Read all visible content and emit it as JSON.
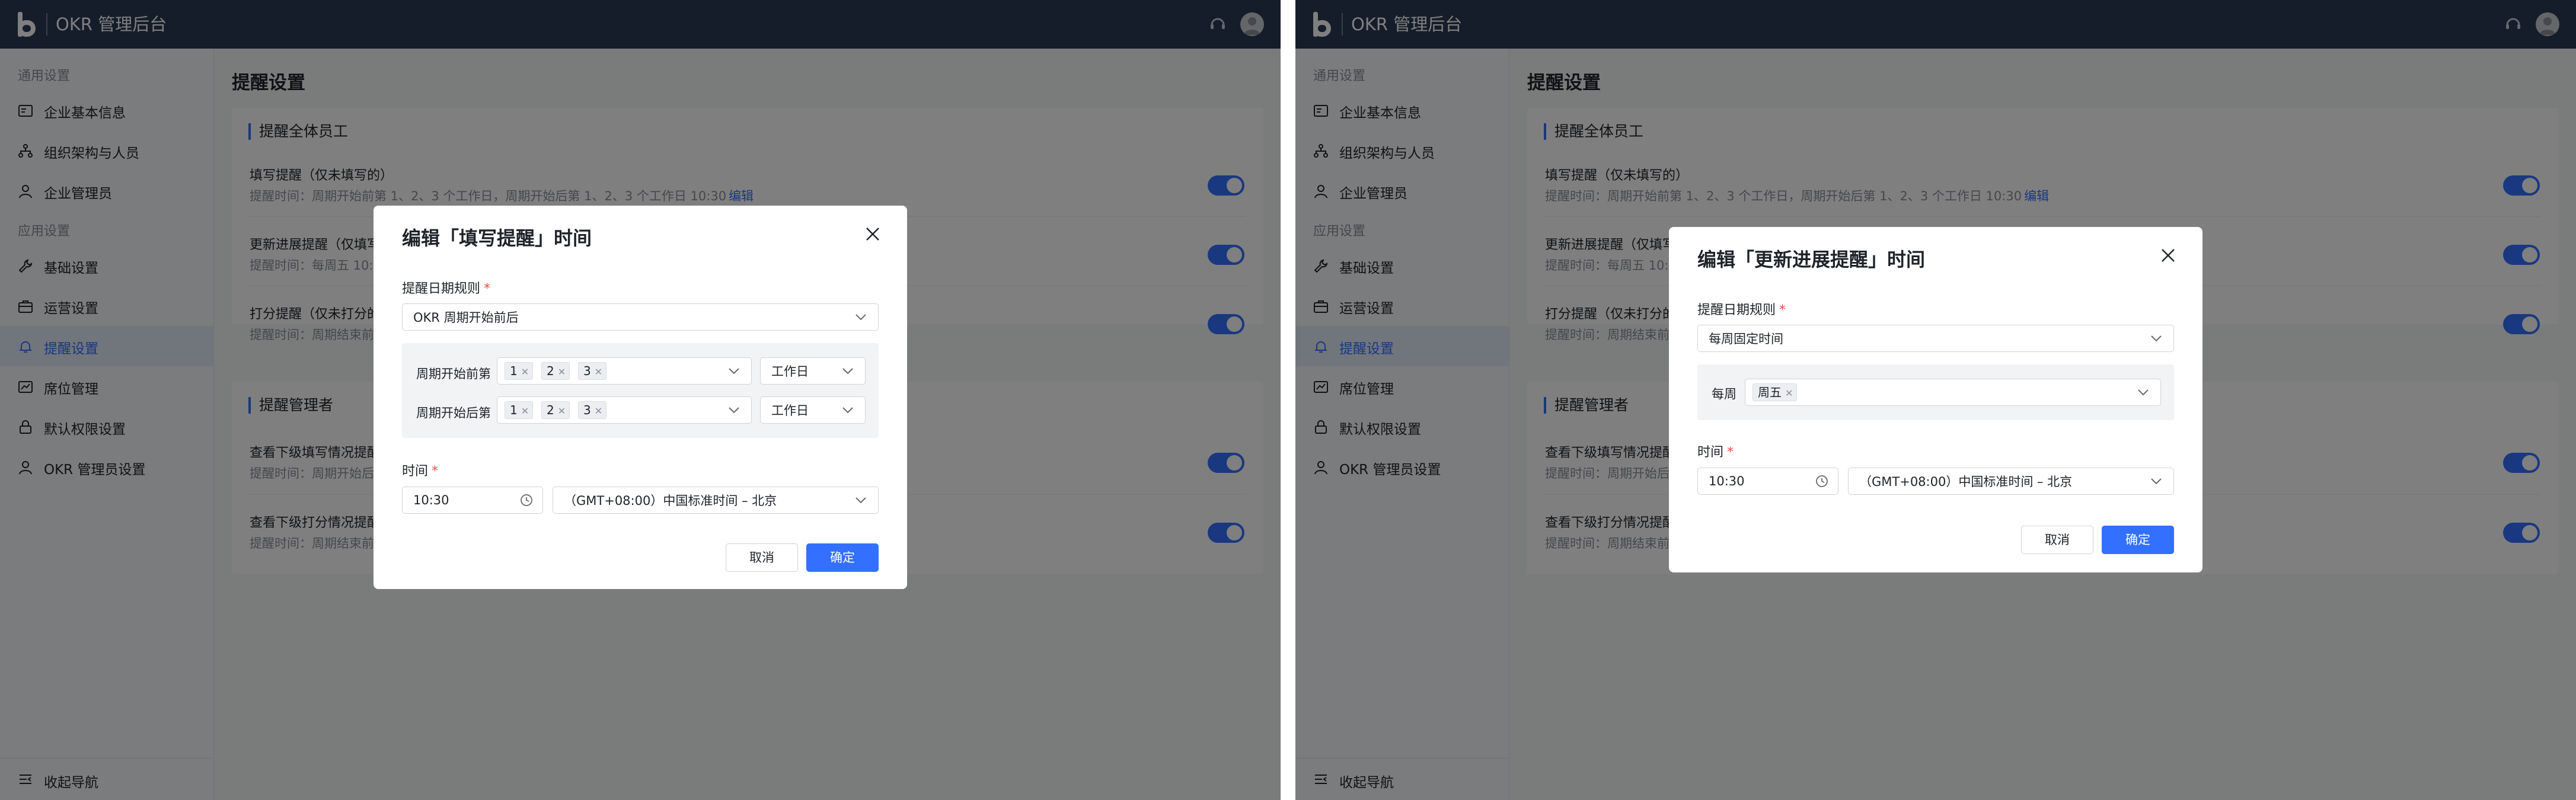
{
  "app": {
    "title": "OKR 管理后台"
  },
  "sidebar": {
    "group_general": "通用设置",
    "group_app": "应用设置",
    "items": [
      {
        "label": "企业基本信息",
        "icon": "company-info-icon"
      },
      {
        "label": "组织架构与人员",
        "icon": "org-structure-icon"
      },
      {
        "label": "企业管理员",
        "icon": "admin-user-icon"
      },
      {
        "label": "基础设置",
        "icon": "wrench-icon"
      },
      {
        "label": "运营设置",
        "icon": "briefcase-icon"
      },
      {
        "label": "提醒设置",
        "icon": "bell-icon",
        "active": true
      },
      {
        "label": "席位管理",
        "icon": "seat-card-icon"
      },
      {
        "label": "默认权限设置",
        "icon": "lock-icon"
      },
      {
        "label": "OKR 管理员设置",
        "icon": "user-icon"
      }
    ],
    "collapse_label": "收起导航"
  },
  "main": {
    "page_title": "提醒设置",
    "section_all": {
      "title": "提醒全体员工",
      "rows": [
        {
          "title": "填写提醒（仅未填写的）",
          "desc": "提醒时间：周期开始前第 1、2、3 个工作日，周期开始后第 1、2、3 个工作日 10:30",
          "edit": "编辑",
          "enabled": true
        },
        {
          "title": "更新进展提醒（仅填写",
          "desc": "提醒时间：每周五 10:3",
          "enabled": true
        },
        {
          "title": "打分提醒（仅未打分的",
          "desc": "提醒时间：周期结束前",
          "enabled": true
        }
      ]
    },
    "section_managers": {
      "title": "提醒管理者",
      "rows": [
        {
          "title": "查看下级填写情况提醒",
          "desc": "提醒时间：周期开始后",
          "enabled": true
        },
        {
          "title": "查看下级打分情况提醒",
          "desc": "提醒时间：周期结束前",
          "enabled": true
        }
      ]
    }
  },
  "main_right": {
    "row1_title": "填写提醒（仅未填写的）",
    "row1_desc": "提醒时间：周期开始前第 1、2、3 个工作日，周期开始后第 1、2、3 个工作日 10:30",
    "row1_edit": "编辑",
    "row2_title": "更新进展提醒（仅填写",
    "row2_desc": "提醒时间：每周五 10:3",
    "row3_title": "打分提醒（仅未打分的",
    "row3_desc": "提醒时间：周期结束前",
    "row4_title": "查看下级填写情况提醒",
    "row4_desc": "提醒时间：周期开始后",
    "row5_title": "查看下级打分情况提醒",
    "row5_desc": "提醒时间：周期结束前"
  },
  "modal_fill": {
    "title": "编辑「填写提醒」时间",
    "date_rule_label": "提醒日期规则",
    "date_rule_value": "OKR 周期开始前后",
    "before_label": "周期开始前第",
    "before_tags": [
      "1",
      "2",
      "3"
    ],
    "before_unit": "工作日",
    "after_label": "周期开始后第",
    "after_tags": [
      "1",
      "2",
      "3"
    ],
    "after_unit": "工作日",
    "time_label": "时间",
    "time_value": "10:30",
    "timezone_value": "（GMT+08:00）中国标准时间 – 北京",
    "cancel_label": "取消",
    "ok_label": "确定"
  },
  "modal_progress": {
    "title": "编辑「更新进展提醒」时间",
    "date_rule_label": "提醒日期规则",
    "date_rule_value": "每周固定时间",
    "weekly_label": "每周",
    "weekly_tags": [
      "周五"
    ],
    "time_label": "时间",
    "time_value": "10:30",
    "timezone_value": "（GMT+08:00）中国标准时间 – 北京",
    "cancel_label": "取消",
    "ok_label": "确定"
  },
  "colors": {
    "topbar": "#2b3a55",
    "accent": "#3370ff",
    "required": "#f54a45"
  }
}
